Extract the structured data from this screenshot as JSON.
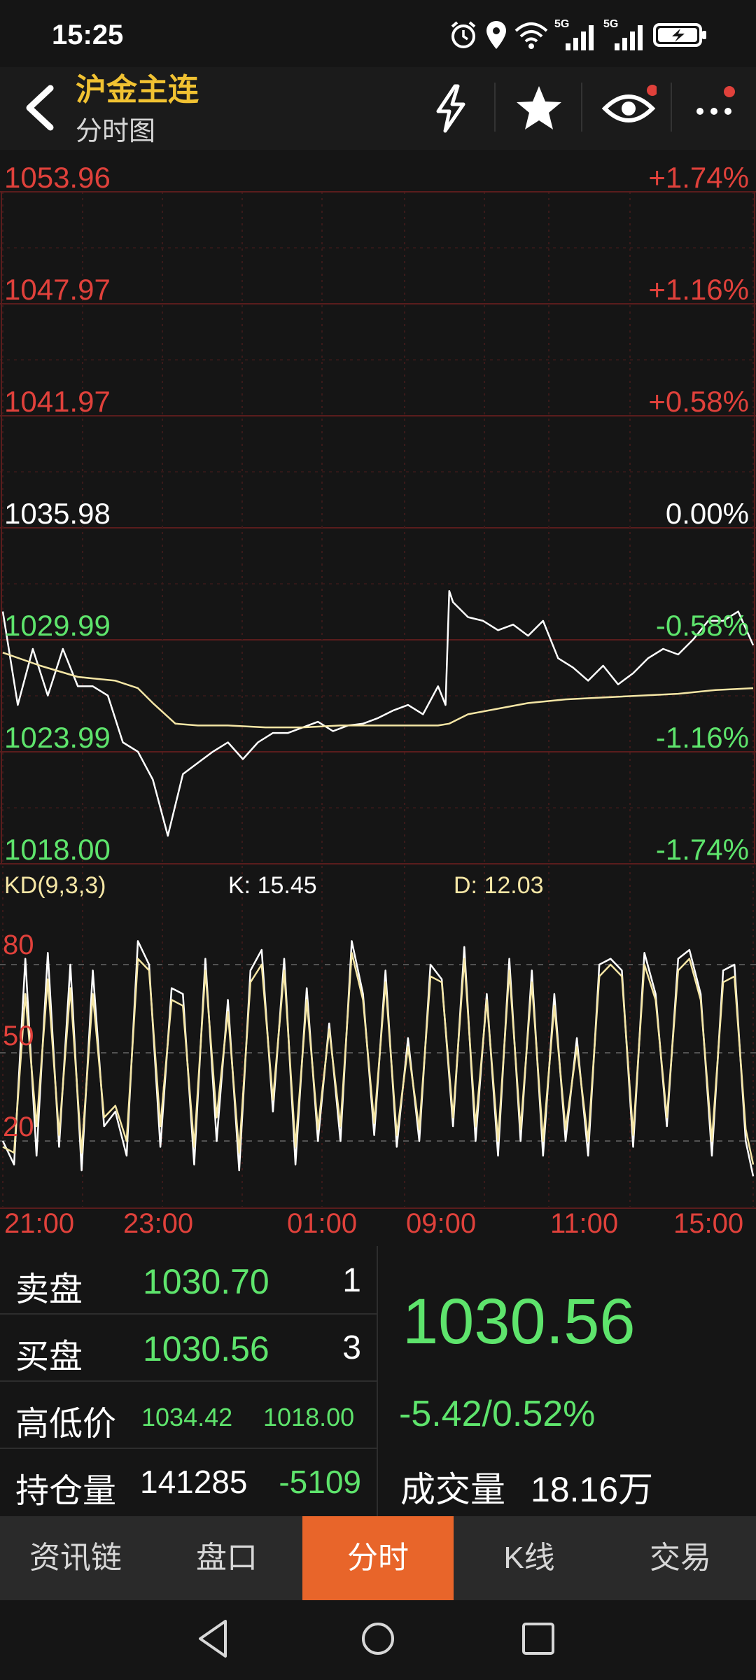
{
  "status": {
    "time": "15:25",
    "icons": [
      "alarm-icon",
      "location-icon",
      "wifi-icon",
      "5g-signal-icon",
      "5g-signal-icon",
      "battery-charging-icon"
    ],
    "signal_label_1": "5G",
    "signal_label_2": "5G"
  },
  "header": {
    "title": "沪金主连",
    "subtitle": "分时图",
    "icons": [
      "back-icon",
      "lightning-icon",
      "star-icon",
      "eye-icon",
      "more-icon"
    ],
    "accent_color": "#f1c232",
    "notify_dot_color": "#e0413b"
  },
  "chart_data": [
    {
      "type": "line",
      "name": "intraday",
      "price_ticks": [
        "1053.96",
        "1047.97",
        "1041.97",
        "1035.98",
        "1029.99",
        "1023.99",
        "1018.00"
      ],
      "pct_ticks": [
        "+1.74%",
        "+1.16%",
        "+0.58%",
        "0.00%",
        "-0.58%",
        "-1.16%",
        "-1.74%"
      ],
      "ylim": [
        1018.0,
        1053.96
      ],
      "reference_price": 1035.98,
      "x_labels": [
        "21:00",
        "23:00",
        "01:00",
        "09:00",
        "11:00",
        "15:00"
      ],
      "series": [
        {
          "color": "#ffffff",
          "x": [
            0,
            0.02,
            0.04,
            0.06,
            0.08,
            0.1,
            0.12,
            0.14,
            0.16,
            0.18,
            0.2,
            0.22,
            0.24,
            0.26,
            0.28,
            0.3,
            0.32,
            0.34,
            0.36,
            0.38,
            0.4,
            0.42,
            0.44,
            0.46,
            0.48,
            0.5,
            0.52,
            0.54,
            0.56,
            0.58,
            0.59,
            0.595,
            0.6,
            0.62,
            0.64,
            0.66,
            0.68,
            0.7,
            0.72,
            0.74,
            0.76,
            0.78,
            0.8,
            0.82,
            0.84,
            0.86,
            0.88,
            0.9,
            0.92,
            0.94,
            0.96,
            0.98,
            1.0
          ],
          "values": [
            1031.5,
            1026.5,
            1029.5,
            1027.0,
            1029.5,
            1027.5,
            1027.5,
            1027.0,
            1024.5,
            1024.0,
            1022.5,
            1019.5,
            1022.8,
            1023.4,
            1024.0,
            1024.5,
            1023.6,
            1024.5,
            1025.0,
            1025.0,
            1025.3,
            1025.6,
            1025.1,
            1025.4,
            1025.5,
            1025.8,
            1026.2,
            1026.5,
            1026.0,
            1027.5,
            1026.5,
            1032.6,
            1032.0,
            1031.2,
            1031.0,
            1030.5,
            1030.8,
            1030.2,
            1031.0,
            1029.0,
            1028.5,
            1027.8,
            1028.6,
            1027.6,
            1028.2,
            1029.0,
            1029.5,
            1029.2,
            1030.0,
            1031.0,
            1031.0,
            1031.5,
            1029.7
          ]
        },
        {
          "color": "#f5e6a5",
          "x": [
            0,
            0.05,
            0.1,
            0.15,
            0.18,
            0.2,
            0.23,
            0.26,
            0.3,
            0.35,
            0.4,
            0.45,
            0.5,
            0.55,
            0.58,
            0.595,
            0.62,
            0.66,
            0.7,
            0.75,
            0.8,
            0.85,
            0.9,
            0.95,
            1.0
          ],
          "values": [
            1029.3,
            1028.6,
            1028.0,
            1027.8,
            1027.4,
            1026.6,
            1025.5,
            1025.4,
            1025.4,
            1025.3,
            1025.3,
            1025.4,
            1025.4,
            1025.4,
            1025.4,
            1025.5,
            1026.0,
            1026.3,
            1026.6,
            1026.8,
            1026.9,
            1027.0,
            1027.1,
            1027.3,
            1027.4
          ]
        }
      ]
    },
    {
      "type": "line",
      "name": "KD",
      "title": "KD(9,3,3)",
      "k_label": "K: 15.45",
      "d_label": "D: 12.03",
      "levels": [
        "80",
        "50",
        "20"
      ],
      "ylim": [
        0,
        100
      ],
      "series": [
        {
          "color": "#ffffff",
          "x": [
            0,
            0.015,
            0.03,
            0.045,
            0.06,
            0.075,
            0.09,
            0.105,
            0.12,
            0.135,
            0.15,
            0.165,
            0.18,
            0.195,
            0.21,
            0.225,
            0.24,
            0.255,
            0.27,
            0.285,
            0.3,
            0.315,
            0.33,
            0.345,
            0.36,
            0.375,
            0.39,
            0.405,
            0.42,
            0.435,
            0.45,
            0.465,
            0.48,
            0.495,
            0.51,
            0.525,
            0.54,
            0.555,
            0.57,
            0.585,
            0.6,
            0.615,
            0.63,
            0.645,
            0.66,
            0.675,
            0.69,
            0.705,
            0.72,
            0.735,
            0.75,
            0.765,
            0.78,
            0.795,
            0.81,
            0.825,
            0.84,
            0.855,
            0.87,
            0.885,
            0.9,
            0.915,
            0.93,
            0.945,
            0.96,
            0.975,
            0.99,
            1.0
          ],
          "values": [
            20,
            12,
            82,
            15,
            84,
            18,
            80,
            10,
            78,
            25,
            30,
            15,
            88,
            80,
            18,
            72,
            70,
            12,
            82,
            20,
            68,
            10,
            78,
            85,
            30,
            82,
            12,
            72,
            20,
            60,
            20,
            88,
            70,
            22,
            78,
            18,
            55,
            20,
            80,
            75,
            25,
            86,
            20,
            70,
            15,
            82,
            20,
            78,
            15,
            70,
            20,
            55,
            15,
            80,
            82,
            78,
            18,
            84,
            70,
            25,
            82,
            85,
            70,
            15,
            78,
            80,
            20,
            8
          ]
        },
        {
          "color": "#f5e6a5",
          "x": [
            0,
            0.015,
            0.03,
            0.045,
            0.06,
            0.075,
            0.09,
            0.105,
            0.12,
            0.135,
            0.15,
            0.165,
            0.18,
            0.195,
            0.21,
            0.225,
            0.24,
            0.255,
            0.27,
            0.285,
            0.3,
            0.315,
            0.33,
            0.345,
            0.36,
            0.375,
            0.39,
            0.405,
            0.42,
            0.435,
            0.45,
            0.465,
            0.48,
            0.495,
            0.51,
            0.525,
            0.54,
            0.555,
            0.57,
            0.585,
            0.6,
            0.615,
            0.63,
            0.645,
            0.66,
            0.675,
            0.69,
            0.705,
            0.72,
            0.735,
            0.75,
            0.765,
            0.78,
            0.795,
            0.81,
            0.825,
            0.84,
            0.855,
            0.87,
            0.885,
            0.9,
            0.915,
            0.93,
            0.945,
            0.96,
            0.975,
            0.99,
            1.0
          ],
          "values": [
            18,
            16,
            70,
            25,
            75,
            22,
            72,
            16,
            70,
            28,
            32,
            20,
            82,
            78,
            25,
            68,
            66,
            18,
            78,
            28,
            64,
            16,
            74,
            80,
            34,
            78,
            18,
            68,
            24,
            58,
            25,
            84,
            68,
            26,
            74,
            22,
            52,
            24,
            76,
            74,
            28,
            82,
            25,
            68,
            20,
            78,
            24,
            74,
            20,
            66,
            24,
            52,
            20,
            76,
            80,
            76,
            22,
            80,
            68,
            28,
            78,
            82,
            68,
            20,
            74,
            76,
            24,
            12
          ]
        }
      ]
    }
  ],
  "quote": {
    "ask_label": "卖盘",
    "ask_price": "1030.70",
    "ask_qty": "1",
    "bid_label": "买盘",
    "bid_price": "1030.56",
    "bid_qty": "3",
    "hilo_label": "高低价",
    "high": "1034.42",
    "low": "1018.00",
    "oi_label": "持仓量",
    "oi_value": "141285",
    "oi_change": "-5109",
    "last_price": "1030.56",
    "change": "-5.42/0.52%",
    "volume_label": "成交量",
    "volume_value": "18.16万"
  },
  "tabs": [
    {
      "label": "资讯链"
    },
    {
      "label": "盘口"
    },
    {
      "label": "分时"
    },
    {
      "label": "K线"
    },
    {
      "label": "交易"
    }
  ],
  "active_tab": "分时",
  "colors": {
    "up": "#e0413b",
    "down": "#5ee46c",
    "neutral": "#ffffff",
    "tab_active": "#e8652a"
  }
}
